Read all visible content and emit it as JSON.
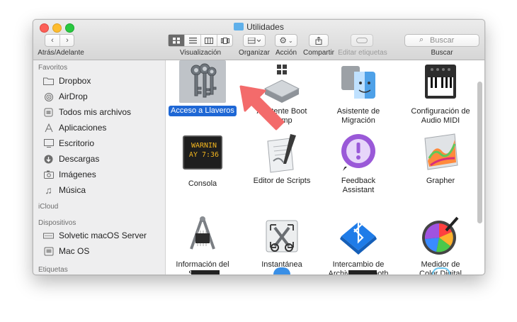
{
  "window": {
    "title": "Utilidades"
  },
  "toolbar": {
    "nav_label": "Atrás/Adelante",
    "view_label": "Visualización",
    "arrange_label": "Organizar",
    "action_label": "Acción",
    "share_label": "Compartir",
    "tags_label": "Editar etiquetas",
    "search_label": "Buscar",
    "search_placeholder": "Buscar"
  },
  "sidebar": {
    "favorites_header": "Favoritos",
    "favorites": [
      {
        "label": "Dropbox",
        "icon": "folder-icon"
      },
      {
        "label": "AirDrop",
        "icon": "airdrop-icon"
      },
      {
        "label": "Todos mis archivos",
        "icon": "all-files-icon"
      },
      {
        "label": "Aplicaciones",
        "icon": "applications-icon"
      },
      {
        "label": "Escritorio",
        "icon": "desktop-icon"
      },
      {
        "label": "Descargas",
        "icon": "downloads-icon"
      },
      {
        "label": "Imágenes",
        "icon": "pictures-icon"
      },
      {
        "label": "Música",
        "icon": "music-icon"
      }
    ],
    "icloud_header": "iCloud",
    "devices_header": "Dispositivos",
    "devices": [
      {
        "label": "Solvetic macOS Server",
        "icon": "computer-icon"
      },
      {
        "label": "Mac OS",
        "icon": "disk-icon"
      }
    ],
    "tags_header": "Etiquetas"
  },
  "apps": [
    {
      "label": "Acceso a Llaveros",
      "selected": true,
      "icon": "keychain-icon"
    },
    {
      "label": "Asistente Boot Camp",
      "icon": "bootcamp-icon"
    },
    {
      "label": "Asistente de Migración",
      "icon": "migration-icon"
    },
    {
      "label": "Configuración de Audio MIDI",
      "icon": "midi-icon"
    },
    {
      "label": "Consola",
      "icon": "console-icon",
      "text": "WARNIN\nAY 7:36"
    },
    {
      "label": "Editor de Scripts",
      "icon": "script-editor-icon"
    },
    {
      "label": "Feedback Assistant",
      "icon": "feedback-icon"
    },
    {
      "label": "Grapher",
      "icon": "grapher-icon"
    },
    {
      "label": "Información del Sistema",
      "icon": "system-info-icon"
    },
    {
      "label": "Instantánea",
      "icon": "grab-icon"
    },
    {
      "label": "Intercambio de Archivo...luetooth",
      "icon": "bluetooth-icon"
    },
    {
      "label": "Medidor de Color Digital",
      "icon": "color-meter-icon"
    }
  ],
  "colors": {
    "selection": "#1e67d5",
    "annotation_arrow": "#f36b6b"
  }
}
